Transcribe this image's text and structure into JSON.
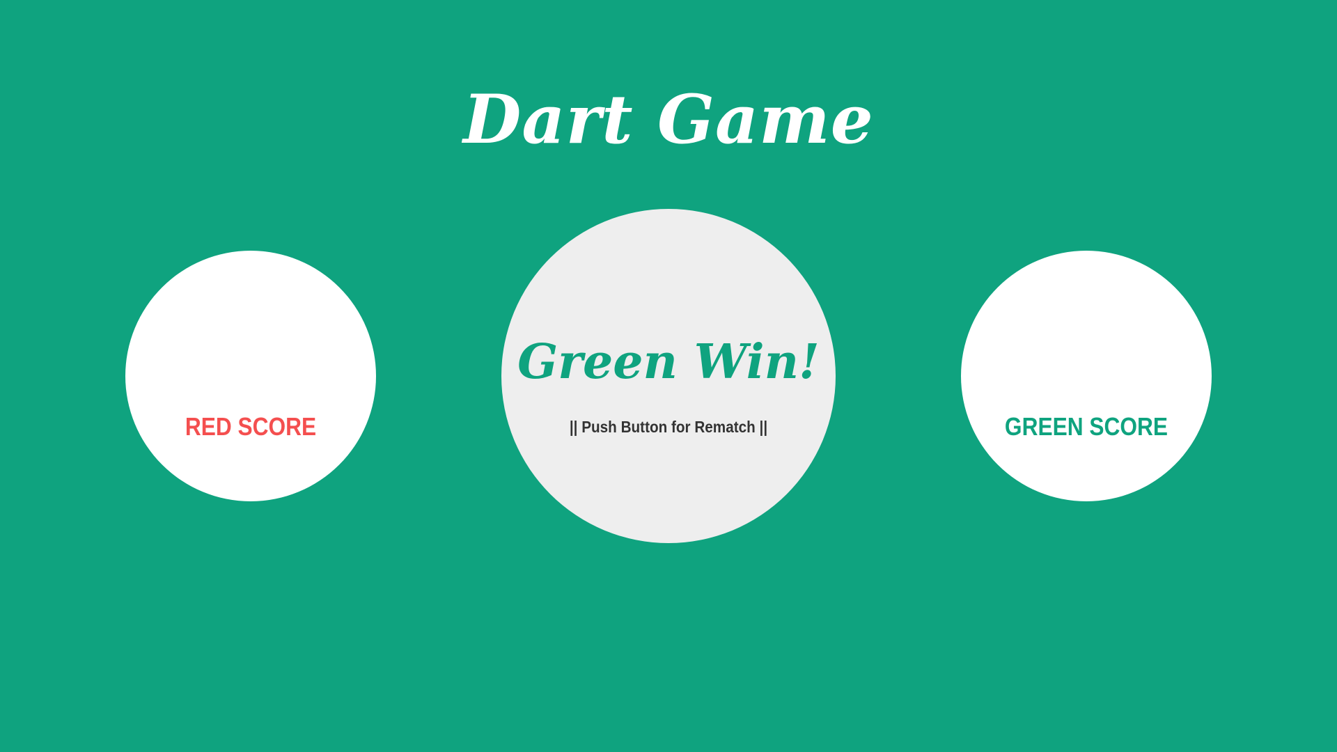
{
  "title": "Dart Game",
  "colors": {
    "background": "#0fa37f",
    "red": "#f44f4f",
    "green": "#0fa37f",
    "circle": "#ffffff",
    "center_circle": "#eeeeee",
    "text_dark": "#333333"
  },
  "scores": {
    "red_label": "RED SCORE",
    "green_label": "GREEN SCORE"
  },
  "center": {
    "winner_text": "Green Win!",
    "rematch_text": "|| Push Button for Rematch ||"
  }
}
